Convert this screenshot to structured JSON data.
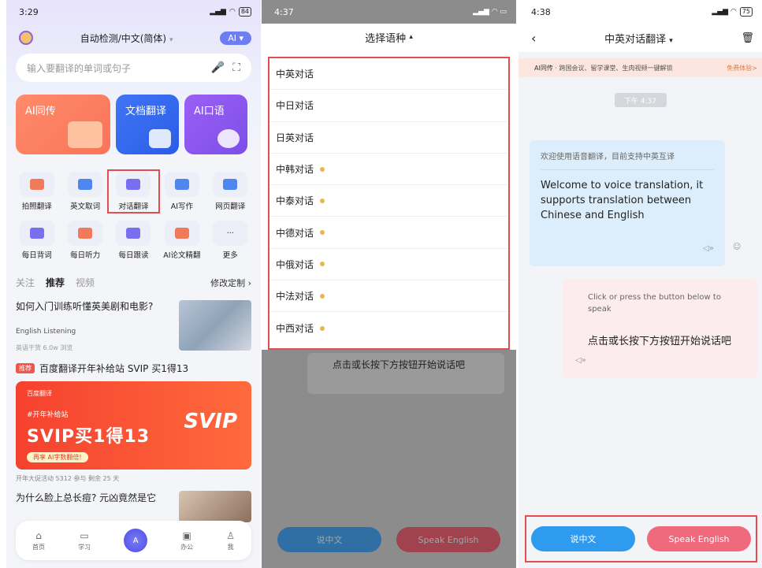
{
  "p1": {
    "status": {
      "time": "3:29",
      "battery": "84"
    },
    "header": {
      "detect": "自动检测/中文(简体)",
      "ai_btn": "AI"
    },
    "search": {
      "placeholder": "输入要翻译的单词或句子"
    },
    "cards": [
      {
        "label": "AI同传"
      },
      {
        "label": "文档翻译"
      },
      {
        "label": "AI口语"
      }
    ],
    "grid": [
      {
        "label": "拍照翻译",
        "color": "#f07a5a"
      },
      {
        "label": "英文取词",
        "color": "#4f86f0"
      },
      {
        "label": "对话翻译",
        "color": "#7a6ef0"
      },
      {
        "label": "AI写作",
        "color": "#4f86f0"
      },
      {
        "label": "网页翻译",
        "color": "#4f86f0"
      },
      {
        "label": "每日背词",
        "color": "#7a6ef0"
      },
      {
        "label": "每日听力",
        "color": "#f07a5a"
      },
      {
        "label": "每日跟读",
        "color": "#7a6ef0"
      },
      {
        "label": "AI论文精翻",
        "color": "#f07a5a"
      },
      {
        "label": "更多",
        "color": "#c8cbd6"
      }
    ],
    "feed_tabs": {
      "follow": "关注",
      "recommend": "推荐",
      "video": "视频",
      "customize": "修改定制"
    },
    "article1": {
      "title": "如何入门训练听懂英美剧和电影?",
      "source": "English Listening",
      "meta": "英语干货  6.0w 浏览"
    },
    "promo": {
      "tag": "推荐",
      "title": "百度翻译开年补给站 SVIP 买1得13"
    },
    "banner": {
      "brand": "百度翻译",
      "hashtag": "#开年补给站",
      "headline": "SVIP买1得13",
      "sub_badge": "再享 AI字数翻倍!",
      "right_text": "SVIP"
    },
    "banner_meta": "开年大促活动  5312 参与  剩余 25 天",
    "article2": {
      "title": "为什么脸上总长痘? 元凶竟然是它"
    },
    "tabbar": [
      {
        "label": "首页"
      },
      {
        "label": "学习"
      },
      {
        "label": ""
      },
      {
        "label": "办公"
      },
      {
        "label": "我"
      }
    ],
    "tabbar_center": "A"
  },
  "p2": {
    "status": {
      "time": "4:37"
    },
    "sheet_title": "选择语种",
    "languages": [
      {
        "label": "中英对话",
        "vip": false
      },
      {
        "label": "中日对话",
        "vip": false
      },
      {
        "label": "日英对话",
        "vip": false
      },
      {
        "label": "中韩对话",
        "vip": true
      },
      {
        "label": "中泰对话",
        "vip": true
      },
      {
        "label": "中德对话",
        "vip": true
      },
      {
        "label": "中俄对话",
        "vip": true
      },
      {
        "label": "中法对话",
        "vip": true
      },
      {
        "label": "中西对话",
        "vip": true
      }
    ],
    "under_text": "点击或长按下方按钮开始说话吧",
    "btn_cn": "说中文",
    "btn_en": "Speak English"
  },
  "p3": {
    "status": {
      "time": "4:38",
      "battery": "75"
    },
    "title": "中英对话翻译",
    "ai_bar": {
      "label": "AI同传",
      "text": "跨国会议、留学课堂、生肉视频一键解锁",
      "cta": "免费体验>"
    },
    "time": "下午 4:37",
    "bubble1": {
      "cn": "欢迎使用语音翻译，目前支持中英互译",
      "en": "Welcome to voice translation, it supports translation between Chinese and English"
    },
    "bubble2": {
      "en": "Click or press the button below to speak",
      "cn": "点击或长按下方按钮开始说话吧"
    },
    "btn_cn": "说中文",
    "btn_en": "Speak English"
  }
}
